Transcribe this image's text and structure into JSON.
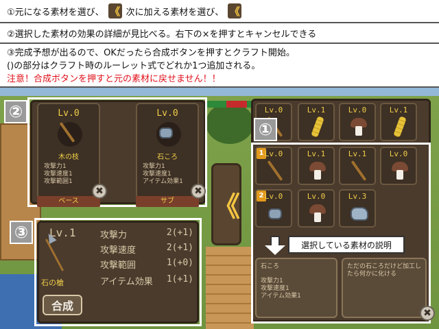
{
  "instructions": {
    "line1_part1": "①元になる素材を選び、",
    "line1_part2": "次に加える素材を選び、",
    "line2": "②選択した素材の効果の詳細が見比べる。右下の×を押すとキャンセルできる",
    "line3a": "③完成予想が出るので、OKだったら合成ボタンを押すとクラフト開始。",
    "line3b": "()の部分はクラフト時のルーレット式でどれか1つ追加される。",
    "warning": "注意！合成ボタンを押すと元の素材に戻せません！！",
    "arrow_glyph": "《"
  },
  "badges": {
    "one": "①",
    "two": "②",
    "three": "③"
  },
  "selected_materials": {
    "base": {
      "level": "Lv.0",
      "name": "木の枝",
      "stats": [
        "攻撃力1",
        "攻撃速度1",
        "攻撃範囲1"
      ],
      "tag": "ベース"
    },
    "sub": {
      "level": "Lv.0",
      "name": "石ころ",
      "stats": [
        "攻撃力1",
        "攻撃速度1",
        "アイテム効果1"
      ],
      "tag": "サブ"
    },
    "close_glyph": "✖"
  },
  "craft_arrow": "《",
  "inventory": {
    "top_row": [
      {
        "level": "Lv.0",
        "item": "stick"
      },
      {
        "level": "Lv.1",
        "item": "wheat"
      },
      {
        "level": "Lv.0",
        "item": "mushroom"
      },
      {
        "level": "Lv.1",
        "item": "wheat"
      }
    ],
    "row2": [
      {
        "level": "Lv.0",
        "item": "stick",
        "badge": "1"
      },
      {
        "level": "Lv.1",
        "item": "mushroom"
      },
      {
        "level": "Lv.1",
        "item": "stick"
      },
      {
        "level": "Lv.0",
        "item": "mushroom"
      }
    ],
    "row3": [
      {
        "level": "Lv.0",
        "item": "stone",
        "badge": "2"
      },
      {
        "level": "Lv.0",
        "item": "mushroom"
      },
      {
        "level": "Lv.3",
        "item": "stone-big"
      }
    ]
  },
  "callout": "選択している素材の説明",
  "description": {
    "name": "石ころ",
    "stats": [
      "攻撃力1",
      "攻撃速度1",
      "アイテム効果1"
    ],
    "flavor": "ただの石ころだけど加工したら何かに化ける"
  },
  "preview": {
    "level": "Lv.1",
    "name": "石の槍",
    "rows": [
      {
        "label": "攻撃力",
        "value": "2(+1)"
      },
      {
        "label": "攻撃速度",
        "value": "2(+1)"
      },
      {
        "label": "攻撃範囲",
        "value": "1(+0)"
      },
      {
        "label": "アイテム効果",
        "value": "1(+1)"
      }
    ],
    "button": "合成"
  },
  "colors": {
    "accent_yellow": "#f2cf4a",
    "warning_red": "#e0101a",
    "panel_brown": "#4a3b2d"
  }
}
